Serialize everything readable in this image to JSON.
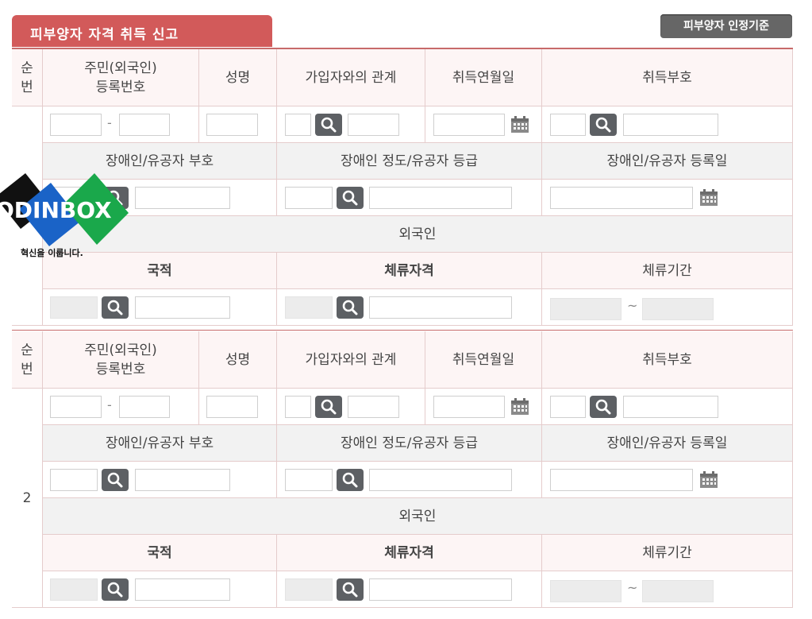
{
  "page": {
    "title": "피부양자 자격 취득 신고",
    "criteria_button": "피부양자 인정기준"
  },
  "headers": {
    "seq": "순\n번",
    "resident_no": "주민(외국인)\n등록번호",
    "name": "성명",
    "relation": "가입자와의 관계",
    "acq_date": "취득연월일",
    "acq_code": "취득부호",
    "disabled_code": "장애인/유공자 부호",
    "disabled_grade": "장애인 정도/유공자 등급",
    "disabled_date": "장애인/유공자 등록일",
    "foreigner": "외국인",
    "nationality": "국적",
    "stay_status": "체류자격",
    "stay_period": "체류기간"
  },
  "rows": [
    {
      "seq": ""
    },
    {
      "seq": "2"
    }
  ],
  "symbols": {
    "dash": "-",
    "tilde": "~"
  },
  "logo": {
    "text": "ODINBOX",
    "tagline": "혁신을 이룹니다."
  },
  "colors": {
    "accent": "#d25a5a",
    "header_bg": "#fdf5f5",
    "grey_bg": "#f2f2f2",
    "search_btn": "#5d6064"
  },
  "icons": [
    "search-icon",
    "calendar-icon"
  ]
}
